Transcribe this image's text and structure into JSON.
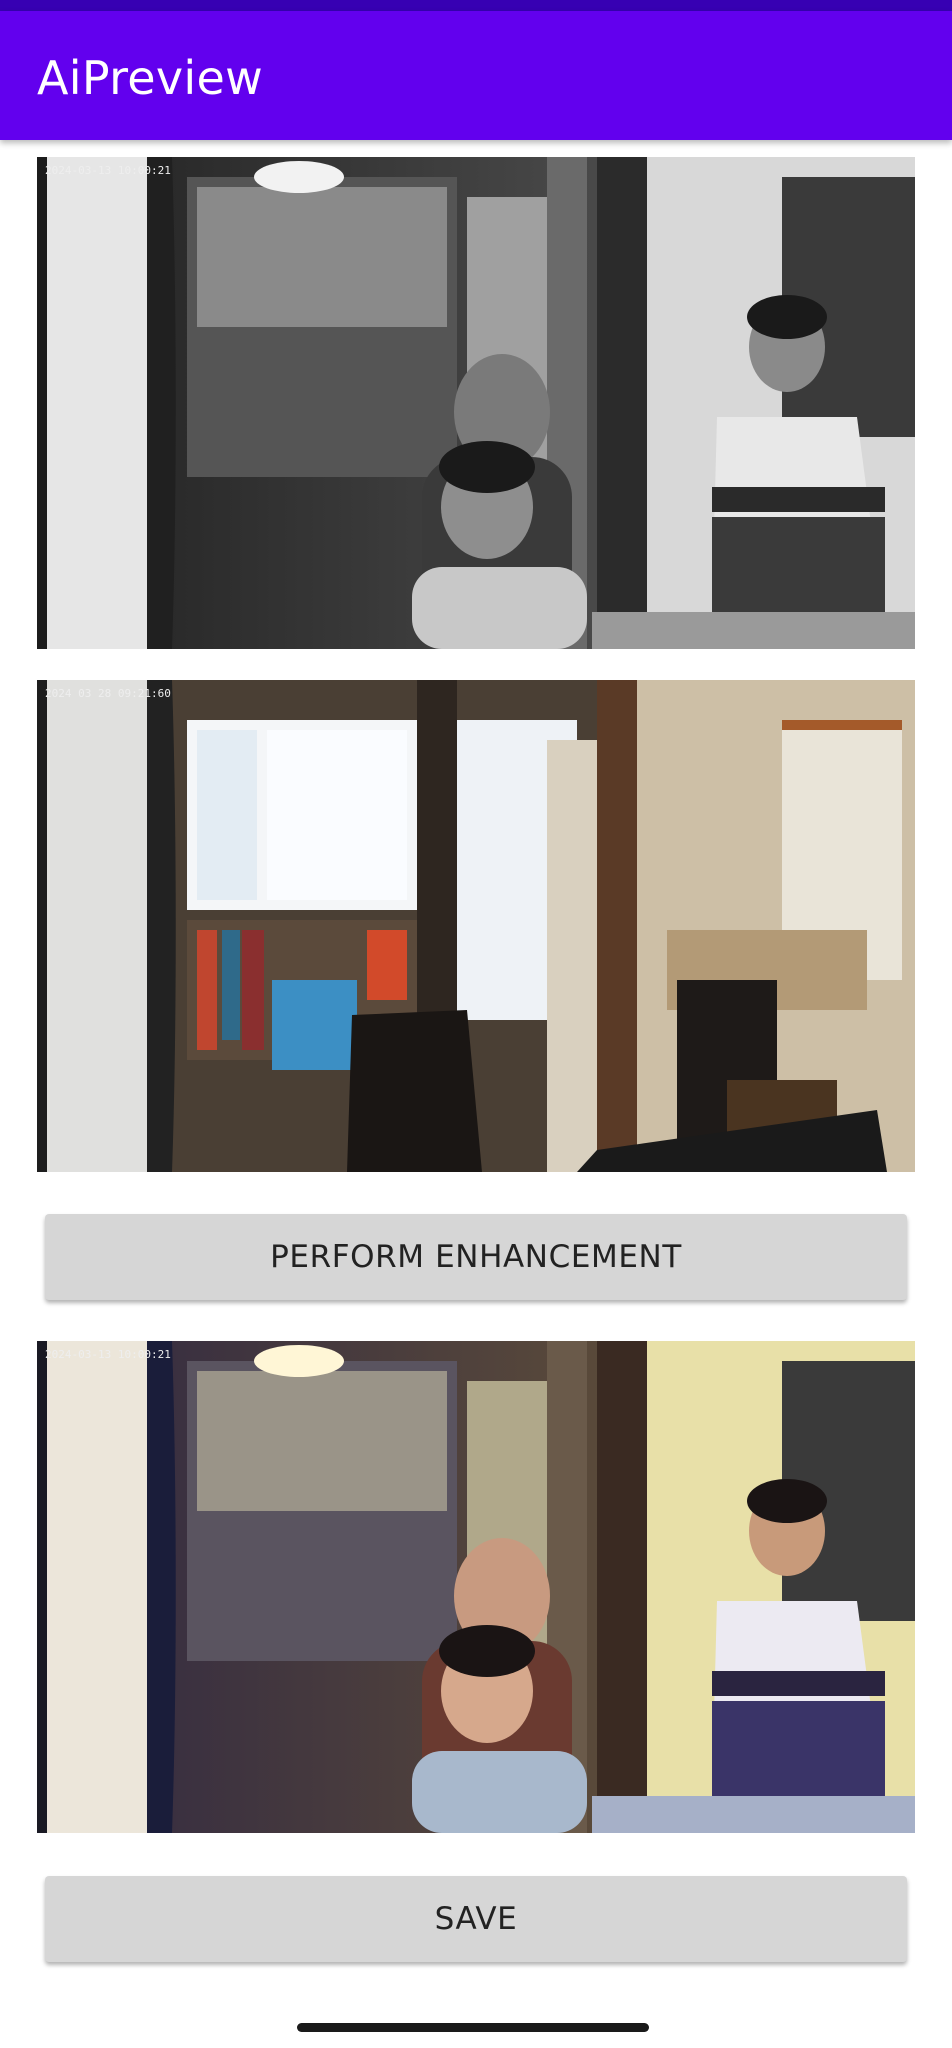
{
  "app_bar": {
    "title": "AiPreview"
  },
  "preview_images": [
    {
      "name": "original-preview",
      "timestamp": "2024-03-13 10:00:21",
      "color": "grayscale"
    },
    {
      "name": "reference-preview",
      "timestamp": "2024 03 28 09:21:60",
      "color": "color"
    },
    {
      "name": "enhanced-preview",
      "timestamp": "2024-03-13 10:00:21",
      "color": "color"
    }
  ],
  "buttons": {
    "enhance_label": "PERFORM ENHANCEMENT",
    "save_label": "SAVE"
  },
  "colors": {
    "primary": "#6200ee",
    "primary_dark": "#3700b3",
    "button_bg": "#d6d6d6"
  }
}
